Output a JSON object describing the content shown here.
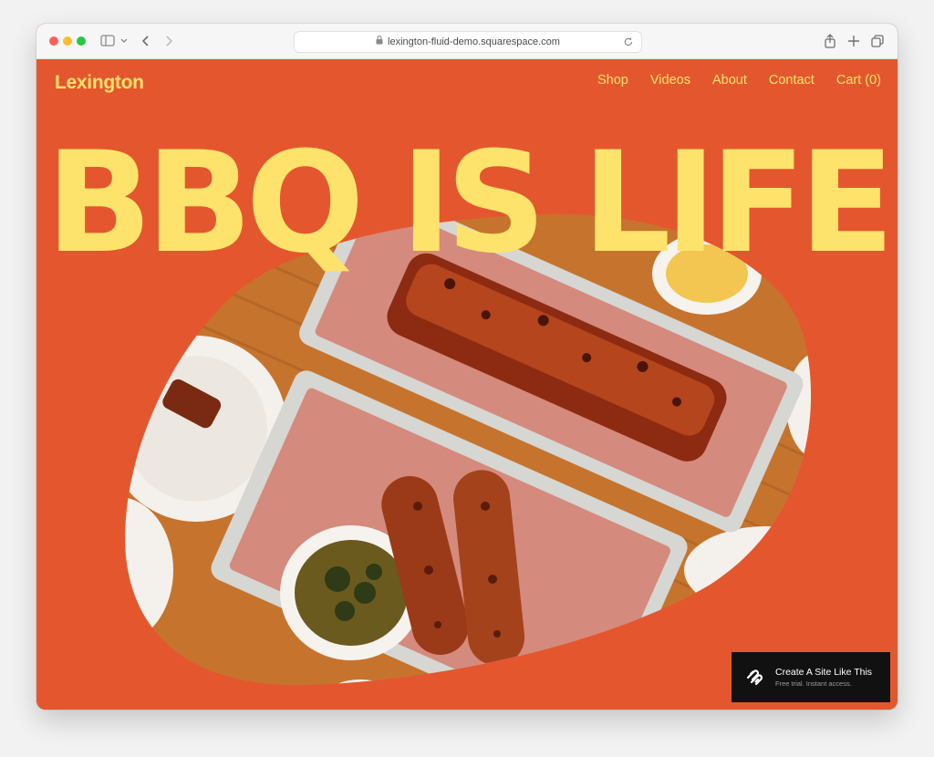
{
  "browser": {
    "url": "lexington-fluid-demo.squarespace.com",
    "icons": {
      "sidebar": "sidebar-icon",
      "chevron": "chevron-down-icon",
      "back": "back-arrow-icon",
      "forward": "forward-arrow-icon",
      "lock": "lock-icon",
      "reload": "reload-icon",
      "share": "share-icon",
      "new_tab": "plus-icon",
      "tabs": "tabs-overview-icon"
    }
  },
  "site": {
    "logo": "Lexington",
    "nav": [
      "Shop",
      "Videos",
      "About",
      "Contact",
      "Cart (0)"
    ],
    "hero_title": "BBQ IS LIFE",
    "colors": {
      "background": "#e4572e",
      "accent": "#fde36b"
    }
  },
  "promo": {
    "title": "Create A Site Like This",
    "subtitle": "Free trial. Instant access.",
    "icon": "squarespace-logo-icon"
  }
}
